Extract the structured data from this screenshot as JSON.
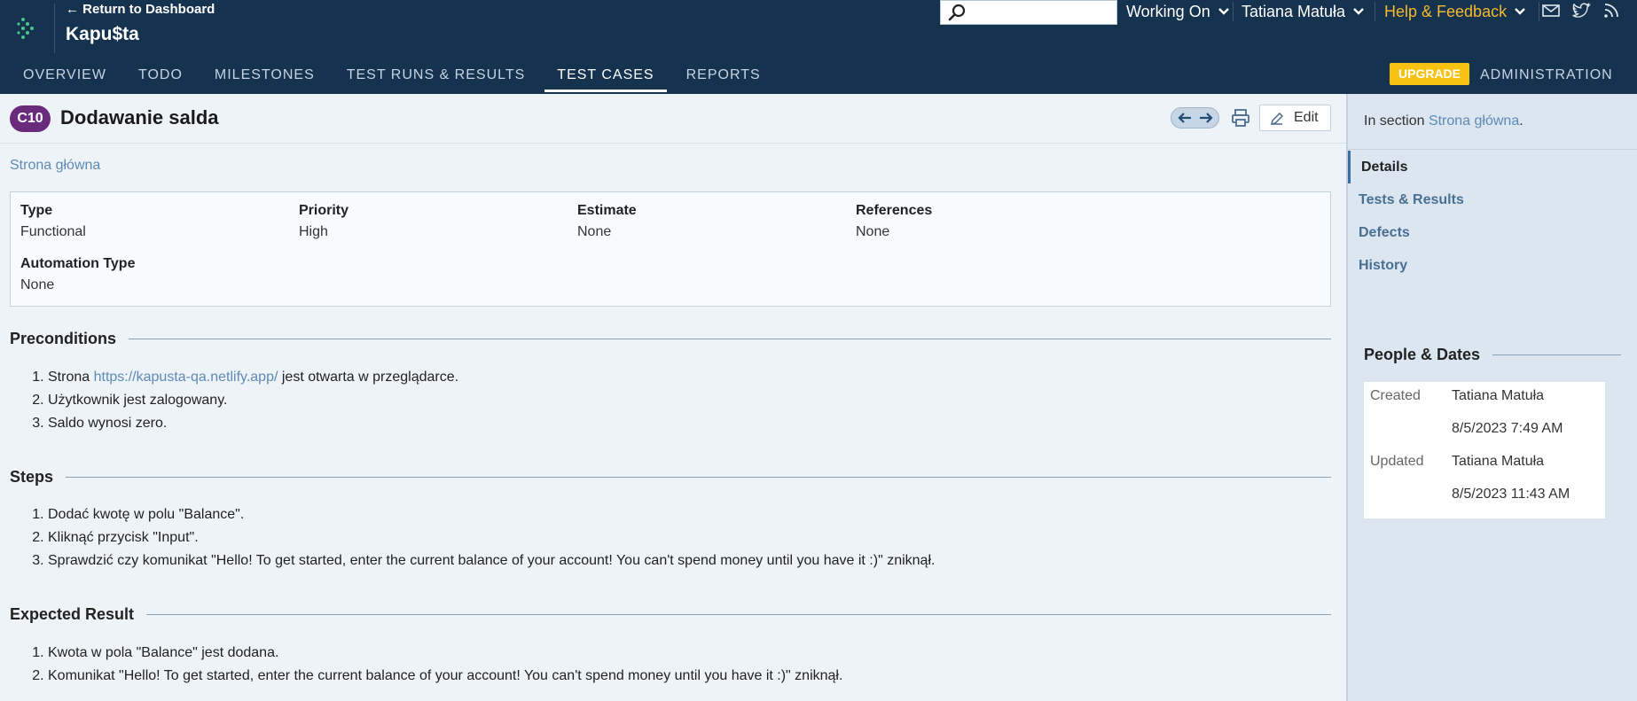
{
  "header": {
    "return_link": "← Return to Dashboard",
    "project_name": "Kapu$ta",
    "search_placeholder": "",
    "working_on": "Working On",
    "user": "Tatiana Matuła",
    "help": "Help & Feedback",
    "icons": [
      "logo-icon",
      "search-icon",
      "mail-icon",
      "twitter-icon",
      "rss-icon"
    ]
  },
  "nav": {
    "tabs": [
      "OVERVIEW",
      "TODO",
      "MILESTONES",
      "TEST RUNS & RESULTS",
      "TEST CASES",
      "REPORTS"
    ],
    "active": "TEST CASES",
    "upgrade": "UPGRADE",
    "administration": "ADMINISTRATION"
  },
  "case": {
    "id": "C10",
    "title": "Dodawanie salda",
    "edit_label": "Edit",
    "section_link": "Strona główna",
    "fields": {
      "type_label": "Type",
      "type_value": "Functional",
      "priority_label": "Priority",
      "priority_value": "High",
      "estimate_label": "Estimate",
      "estimate_value": "None",
      "references_label": "References",
      "references_value": "None",
      "automation_label": "Automation Type",
      "automation_value": "None"
    },
    "preconditions": {
      "heading": "Preconditions",
      "item1_prefix": "Strona ",
      "item1_link": "https://kapusta-qa.netlify.app/",
      "item1_suffix": " jest otwarta w przeglądarce.",
      "item2": "Użytkownik jest zalogowany.",
      "item3": "Saldo wynosi zero."
    },
    "steps": {
      "heading": "Steps",
      "items": [
        "Dodać kwotę w polu \"Balance\".",
        "Kliknąć przycisk \"Input\".",
        "Sprawdzić czy komunikat \"Hello! To get started, enter the current balance of your account! You can't spend money until you have it :)\" zniknął."
      ]
    },
    "expected": {
      "heading": "Expected Result",
      "items": [
        "Kwota w pola \"Balance\" jest dodana.",
        "Komunikat \"Hello! To get started, enter the current balance of your account! You can't spend money until you have it :)\" zniknął."
      ]
    }
  },
  "sidebar": {
    "in_section_prefix": "In section ",
    "in_section_link": "Strona główna",
    "in_section_suffix": ".",
    "items": [
      "Details",
      "Tests & Results",
      "Defects",
      "History"
    ],
    "active": "Details",
    "people_heading": "People & Dates",
    "created_label": "Created",
    "created_by": "Tatiana Matuła",
    "created_at": "8/5/2023 7:49 AM",
    "updated_label": "Updated",
    "updated_by": "Tatiana Matuła",
    "updated_at": "8/5/2023 11:43 AM"
  },
  "colors": {
    "header_bg": "#15324f",
    "accent_link": "#5d8ab5",
    "badge": "#6a2b7c",
    "upgrade": "#f7c313",
    "help": "#f5b82e"
  }
}
